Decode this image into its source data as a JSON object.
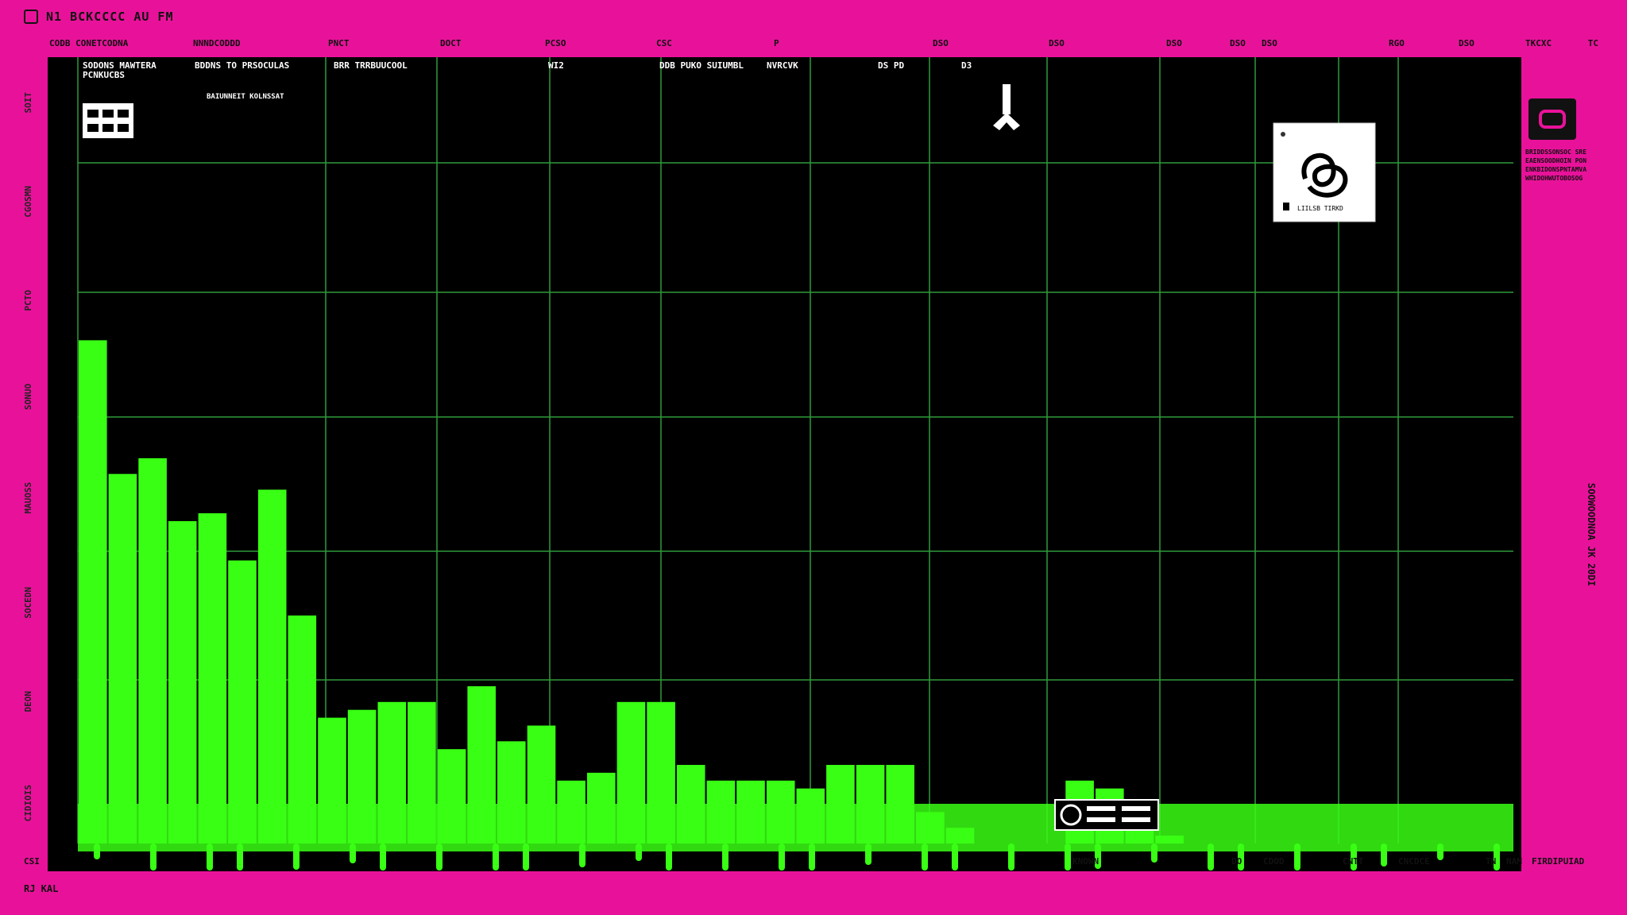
{
  "window": {
    "title": "N1 BCKCCCC AU FM"
  },
  "header": {
    "columns": [
      "CODB CONETCODNA",
      "NNNDCODDD",
      "PNCT",
      "DOCT",
      "PCSO",
      "CSC",
      "P",
      "DSO",
      "DSO",
      "DSO",
      "DSO",
      "DSO",
      "RGO",
      "DSO"
    ],
    "right_labels": [
      "TKCXC",
      "TC"
    ]
  },
  "left_rail": {
    "labels": [
      "SOIT",
      "CGOSMN",
      "PCTO",
      "SONUO",
      "MAUOSS",
      "SOCEDN",
      "DEON",
      "CIDIOIS"
    ]
  },
  "panel": {
    "top_texts": [
      "SODONS MAWTERA",
      "PCNKUCBS",
      "BDDNS TO PRSOCULAS",
      "BRR TRRBUUCOOL",
      "WI2",
      "DDB PUKO SUIUMBL",
      "NVRCVK",
      "DS PD",
      "D3"
    ],
    "sub_text": "BAIUNNEIT KOLNSSAT",
    "card_caption": "LIILSB TIRKD"
  },
  "right_rail": {
    "status_text": "BRIDDSSONSOC SREEAENSOODHOIN PONENKBIDONSPNTAMVAWHIDOHWUTOBOSOG",
    "side_label": "SOOWOODNOA JK 20DI"
  },
  "bottom": {
    "labels": [
      "CSI",
      "KNOWN",
      "DO",
      "CDOD",
      "CNTT",
      "CNCDCE",
      "TN",
      "NAM",
      "FIRDIPUIAD"
    ]
  },
  "footer": {
    "text": "RJ KAL"
  },
  "colors": {
    "background": "#e8129a",
    "plot_bg": "#000000",
    "bars": "#39ff14",
    "grid": "#2f9a3a"
  },
  "icons": [
    "window-icon",
    "grid-logo-icon",
    "pin-icon",
    "swirl-logo-icon",
    "rail-app-icon",
    "badge-icon"
  ],
  "chart_data": {
    "type": "bar",
    "title": "",
    "xlabel": "",
    "ylabel": "",
    "ylim": [
      0,
      100
    ],
    "grid": true,
    "values": [
      64,
      47,
      49,
      41,
      42,
      36,
      45,
      29,
      16,
      17,
      18,
      18,
      12,
      20,
      13,
      15,
      8,
      9,
      18,
      18,
      10,
      8,
      8,
      8,
      7,
      10,
      10,
      10,
      4,
      2,
      0,
      0,
      0,
      8,
      7,
      2,
      1,
      0,
      0,
      0,
      0,
      0,
      0,
      0,
      0,
      0,
      0,
      0
    ]
  }
}
